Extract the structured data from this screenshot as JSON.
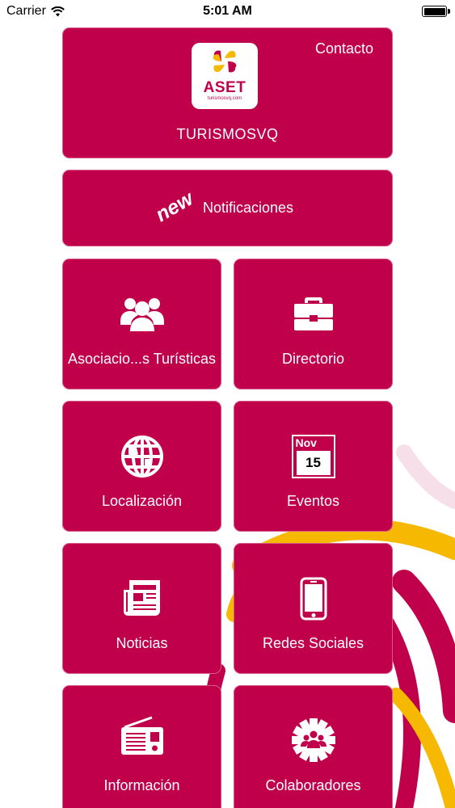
{
  "status_bar": {
    "carrier": "Carrier",
    "time": "5:01 AM"
  },
  "header": {
    "contact_label": "Contacto",
    "logo_text": "ASET",
    "logo_subtext": "turismosvq.com",
    "brand_name": "TURISMOSVQ"
  },
  "notifications": {
    "badge": "new",
    "label": "Notificaciones"
  },
  "tiles": [
    {
      "label": "Asociacio...s Turísticas",
      "icon": "users-icon"
    },
    {
      "label": "Directorio",
      "icon": "briefcase-icon"
    },
    {
      "label": "Localización",
      "icon": "globe-icon"
    },
    {
      "label": "Eventos",
      "icon": "calendar-icon"
    },
    {
      "label": "Noticias",
      "icon": "newspaper-icon"
    },
    {
      "label": "Redes Sociales",
      "icon": "smartphone-icon"
    },
    {
      "label": "Información",
      "icon": "radio-icon"
    },
    {
      "label": "Colaboradores",
      "icon": "collaborators-badge-icon"
    }
  ],
  "calendar_icon": {
    "month": "Nov",
    "day": "15"
  },
  "colors": {
    "tile": "#c1004c",
    "accent_yellow": "#f6b800",
    "text": "#ffffff"
  }
}
